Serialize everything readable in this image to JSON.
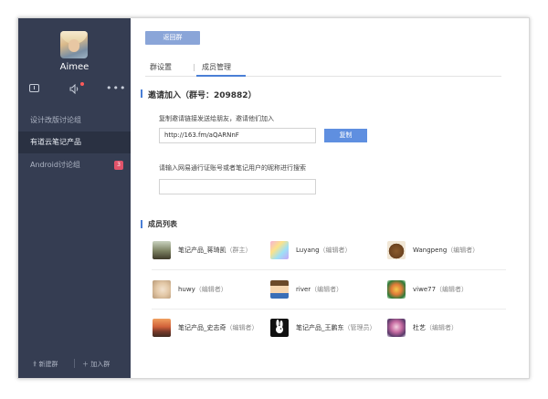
{
  "sidebar": {
    "username": "Aimee",
    "groups": [
      {
        "label": "设计改版讨论组"
      },
      {
        "label": "有道云笔记产品"
      },
      {
        "label": "Android讨论组",
        "badge": "3"
      }
    ],
    "new_group_label": "新建群",
    "join_group_label": "加入群"
  },
  "main": {
    "back_label": "返回群",
    "tabs": [
      {
        "label": "群设置"
      },
      {
        "label": "成员管理"
      }
    ],
    "invite_title": "邀请加入（群号：209882）",
    "invite_hint": "复制邀请链接发送给朋友，邀请他们加入",
    "invite_link": "http://163.fm/aQARNnF",
    "copy_label": "复制",
    "search_hint": "请输入网易通行证账号或者笔记用户的昵称进行搜索",
    "search_placeholder": "",
    "members_title": "成员列表",
    "members": [
      {
        "name": "笔记产品_蒋琦凯",
        "role": "（群主）"
      },
      {
        "name": "Luyang",
        "role": "（编辑者）"
      },
      {
        "name": "Wangpeng",
        "role": "（编辑者）"
      },
      {
        "name": "huwy",
        "role": "（编辑者）"
      },
      {
        "name": "river",
        "role": "（编辑者）"
      },
      {
        "name": "viwe77",
        "role": "（编辑者）"
      },
      {
        "name": "笔记产品_史志奇",
        "role": "（编辑者）"
      },
      {
        "name": "笔记产品_王鹏东",
        "role": "（管理员）"
      },
      {
        "name": "杜艺",
        "role": "（编辑者）"
      }
    ]
  },
  "colors": {
    "sidebar_bg": "#353d52",
    "accent": "#4a7fd6",
    "button": "#5f8fe0"
  }
}
